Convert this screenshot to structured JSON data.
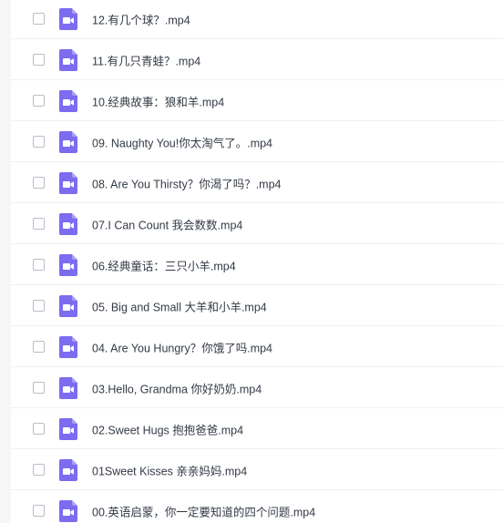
{
  "files": [
    {
      "name": "12.有几个球？.mp4"
    },
    {
      "name": "11.有几只青蛙？.mp4"
    },
    {
      "name": "10.经典故事：狼和羊.mp4"
    },
    {
      "name": "09. Naughty You!你太淘气了。.mp4"
    },
    {
      "name": "08. Are You Thirsty？你渴了吗？.mp4"
    },
    {
      "name": "07.I Can Count 我会数数.mp4"
    },
    {
      "name": "06.经典童话：三只小羊.mp4"
    },
    {
      "name": "05. Big and Small 大羊和小羊.mp4"
    },
    {
      "name": "04. Are You Hungry？你饿了吗.mp4"
    },
    {
      "name": "03.Hello, Grandma 你好奶奶.mp4"
    },
    {
      "name": "02.Sweet Hugs 抱抱爸爸.mp4"
    },
    {
      "name": "01Sweet Kisses 亲亲妈妈.mp4"
    },
    {
      "name": "00.英语启蒙，你一定要知道的四个问题.mp4"
    }
  ],
  "icon": {
    "name": "video-file-icon",
    "color": "#7b6cf0"
  },
  "checkbox_border_color": "#b9bec7"
}
